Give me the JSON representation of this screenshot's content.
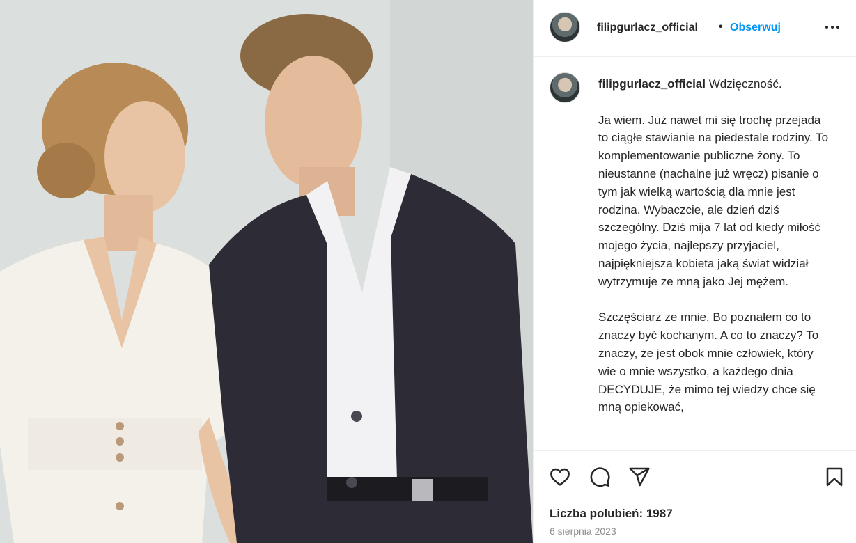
{
  "photo": {
    "alt_icon": "post-photo"
  },
  "header": {
    "username": "filipgurlacz_official",
    "separator": "•",
    "follow_label": "Obserwuj",
    "more_icon": "more-horizontal-icon"
  },
  "caption": {
    "username": "filipgurlacz_official",
    "title": "Wdzięczność.",
    "paragraph1": "Ja wiem. Już nawet mi się trochę przejada to ciągłe stawianie na piedestale rodziny. To komplementowanie publiczne żony. To nieustanne (nachalne już wręcz) pisanie o tym jak wielką wartością dla mnie jest rodzina. Wybaczcie, ale dzień dziś szczególny. Dziś mija 7 lat od kiedy miłość mojego życia, najlepszy przyjaciel, najpiękniejsza kobieta jaką świat widział wytrzymuje ze mną jako Jej mężem.",
    "paragraph2": "Szczęściarz ze mnie. Bo poznałem co to znaczy być kochanym. A co to znaczy? To znaczy, że jest obok mnie człowiek, który wie o mnie wszystko, a każdego dnia DECYDUJE, że mimo tej wiedzy chce się mną opiekować,"
  },
  "actions": {
    "like_icon": "heart-icon",
    "comment_icon": "comment-icon",
    "share_icon": "send-icon",
    "save_icon": "bookmark-icon"
  },
  "likes_text": "Liczba polubień: 1987",
  "date_text": "6 sierpnia 2023"
}
